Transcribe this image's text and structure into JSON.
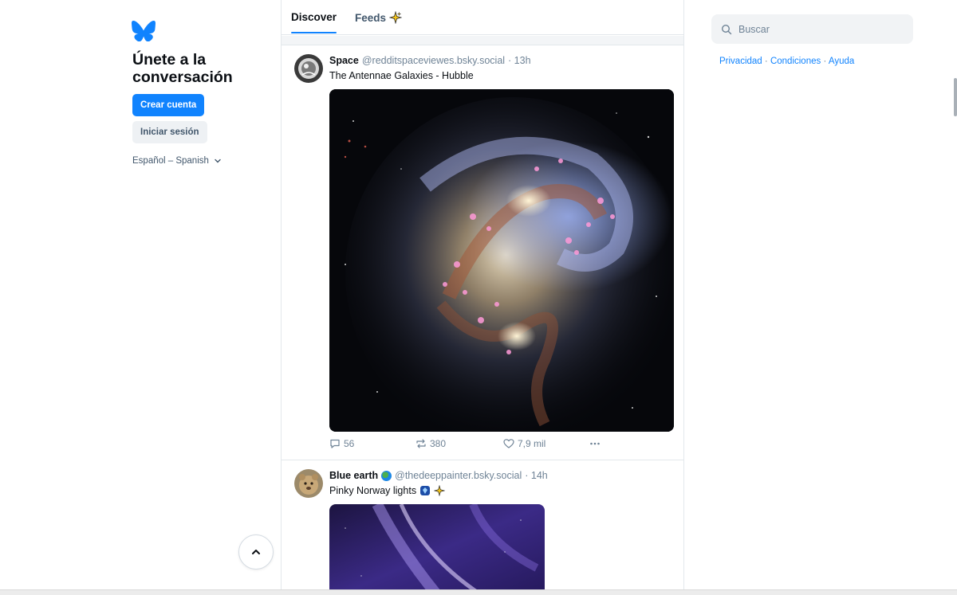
{
  "left": {
    "join_title": "Únete a la conversación",
    "create_account": "Crear cuenta",
    "login": "Iniciar sesión",
    "language": "Español – Spanish"
  },
  "tabs": {
    "discover": "Discover",
    "feeds": "Feeds"
  },
  "posts": [
    {
      "author": "Space",
      "handle": "@redditspaceviewes.bsky.social",
      "time": "· 13h",
      "text": "The Antennae Galaxies - Hubble",
      "replies": "56",
      "reposts": "380",
      "likes": "7,9 mil"
    },
    {
      "author": "Blue earth",
      "handle": "@thedeeppainter.bsky.social",
      "time": "· 14h",
      "text": "Pinky Norway lights"
    }
  ],
  "search": {
    "placeholder": "Buscar"
  },
  "footer": {
    "privacy": "Privacidad",
    "terms": "Condiciones",
    "help": "Ayuda",
    "separator": "·"
  },
  "colors": {
    "brand": "#1083fe",
    "muted": "#6f8396",
    "border": "#e3e8ec"
  },
  "icons": [
    "butterfly-logo-icon",
    "chevron-down-icon",
    "chevron-up-icon",
    "sparkle-icon",
    "search-icon",
    "reply-icon",
    "repost-icon",
    "heart-icon",
    "more-icon",
    "globe-icon"
  ]
}
